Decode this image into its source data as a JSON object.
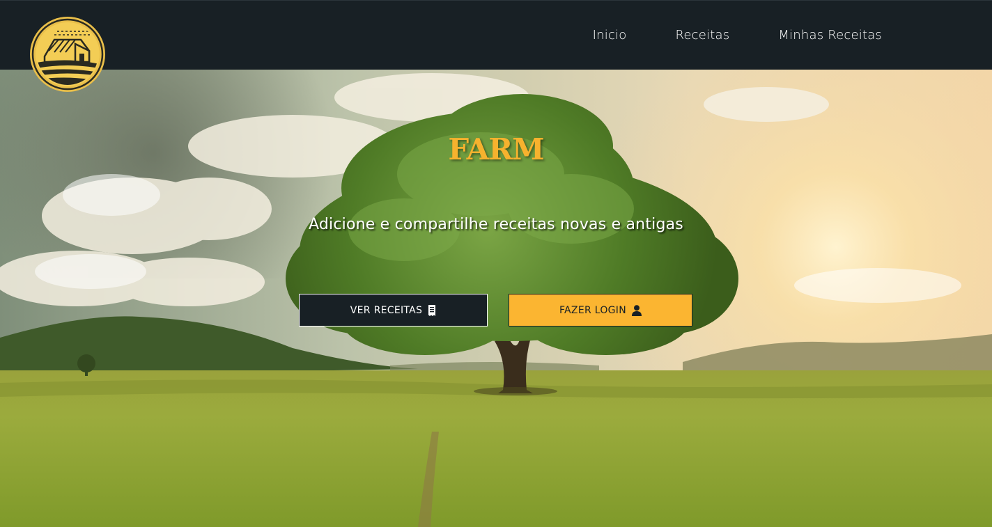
{
  "nav": {
    "logo_alt": "Farm logo",
    "links": [
      {
        "label": "Inicio"
      },
      {
        "label": "Receitas"
      },
      {
        "label": "Minhas Receitas"
      }
    ]
  },
  "hero": {
    "title": "FARM",
    "subtitle": "Adicione e compartilhe receitas novas e antigas",
    "buttons": {
      "primary": {
        "label": "VER RECEITAS",
        "icon": "receipt-icon"
      },
      "secondary": {
        "label": "FAZER LOGIN",
        "icon": "user-icon"
      }
    }
  },
  "colors": {
    "navbar": "#182025",
    "accent": "#fbb531",
    "title": "#f7b22e"
  }
}
